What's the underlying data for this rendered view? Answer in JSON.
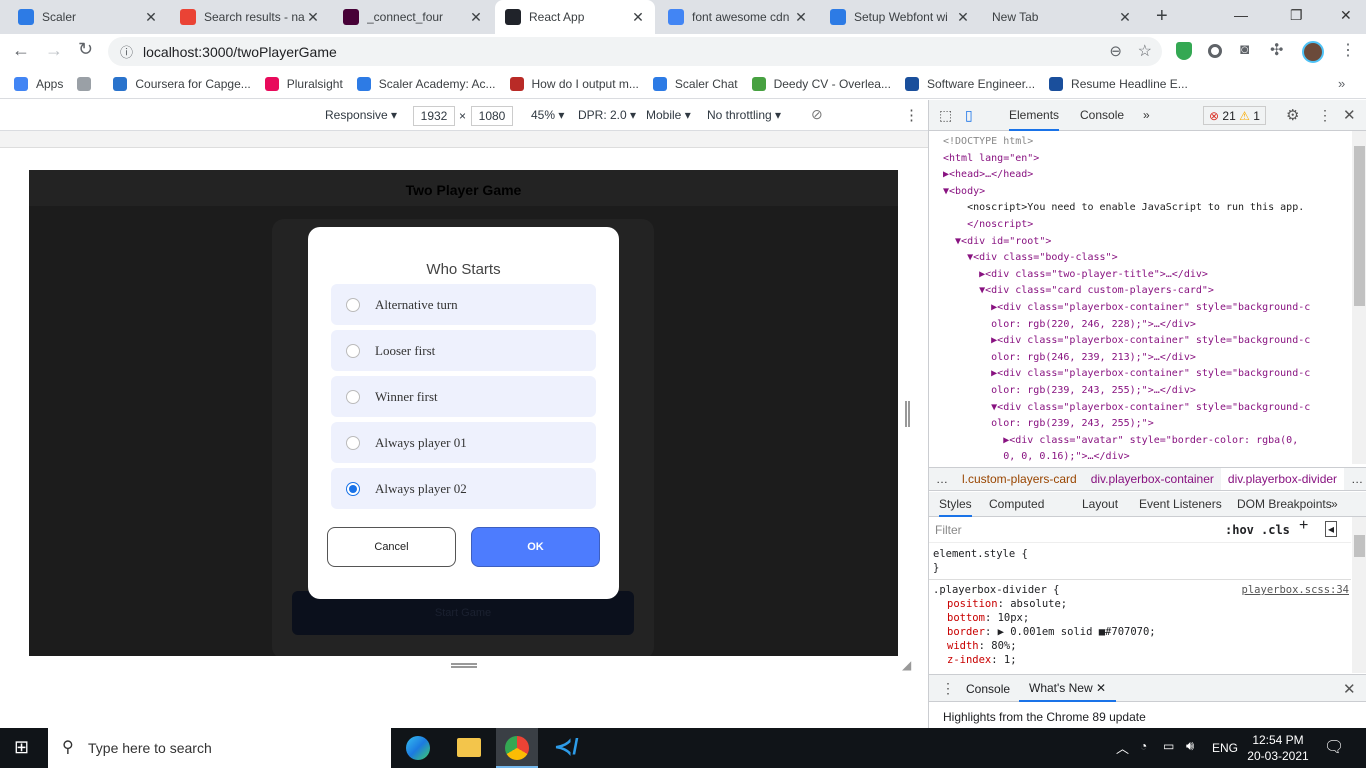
{
  "browser": {
    "tabs": [
      {
        "title": "Scaler",
        "icon": "scaler-icon",
        "color": "#2d7be5"
      },
      {
        "title": "Search results - na",
        "icon": "gmail-icon",
        "color": "#ea4335"
      },
      {
        "title": "_connect_four",
        "icon": "adobe-xd-icon",
        "color": "#470137"
      },
      {
        "title": "React App",
        "icon": "react-icon",
        "color": "#20232a",
        "active": true
      },
      {
        "title": "font awesome cdn",
        "icon": "google-icon",
        "color": "#4285f4"
      },
      {
        "title": "Setup Webfont wi",
        "icon": "flag-icon",
        "color": "#2d7be5"
      },
      {
        "title": "New Tab",
        "icon": "",
        "color": ""
      }
    ],
    "url": "localhost:3000/twoPlayerGame",
    "bookmarks": [
      {
        "label": "Apps",
        "color": "#4285f4"
      },
      {
        "label": "",
        "color": "#9aa0a6"
      },
      {
        "label": "Coursera for Capge...",
        "color": "#2a73cc"
      },
      {
        "label": "Pluralsight",
        "color": "#e80a5b"
      },
      {
        "label": "Scaler Academy: Ac...",
        "color": "#2d7be5"
      },
      {
        "label": "How do I output m...",
        "color": "#b92b27"
      },
      {
        "label": "Scaler Chat",
        "color": "#2d7be5"
      },
      {
        "label": "Deedy CV - Overlea...",
        "color": "#47a141"
      },
      {
        "label": "Software Engineer...",
        "color": "#1a4f9c"
      },
      {
        "label": "Resume Headline E...",
        "color": "#1a4f9c"
      }
    ]
  },
  "device_toolbar": {
    "mode": "Responsive",
    "width": "1932",
    "height": "1080",
    "zoom": "45%",
    "dpr": "DPR: 2.0",
    "device": "Mobile",
    "throttle": "No throttling",
    "times": "×"
  },
  "app": {
    "title": "Two Player Game",
    "start_button": "Start Game",
    "modal": {
      "title": "Who Starts",
      "options": [
        {
          "label": "Alternative turn",
          "checked": false
        },
        {
          "label": "Looser first",
          "checked": false
        },
        {
          "label": "Winner first",
          "checked": false
        },
        {
          "label": "Always player 01",
          "checked": false
        },
        {
          "label": "Always player 02",
          "checked": true
        }
      ],
      "cancel": "Cancel",
      "ok": "OK",
      "accent": "#4d7cfe"
    }
  },
  "devtools": {
    "tabs": [
      "Elements",
      "Console"
    ],
    "errors": "21",
    "warnings": "1",
    "elements": [
      "<!DOCTYPE html>",
      "<html lang=\"en\">",
      "▶<head>…</head>",
      "▼<body>",
      "    <noscript>You need to enable JavaScript to run this app.",
      "    </noscript>",
      "  ▼<div id=\"root\">",
      "    ▼<div class=\"body-class\">",
      "      ▶<div class=\"two-player-title\">…</div>",
      "      ▼<div class=\"card custom-players-card\">",
      "        ▶<div class=\"playerbox-container\" style=\"background-c",
      "        olor: rgb(220, 246, 228);\">…</div>",
      "        ▶<div class=\"playerbox-container\" style=\"background-c",
      "        olor: rgb(246, 239, 213);\">…</div>",
      "        ▶<div class=\"playerbox-container\" style=\"background-c",
      "        olor: rgb(239, 243, 255);\">…</div>",
      "        ▼<div class=\"playerbox-container\" style=\"background-c",
      "        olor: rgb(239, 243, 255);\">",
      "          ▶<div class=\"avatar\" style=\"border-color: rgba(0,",
      "          0, 0, 0.16);\">…</div>"
    ],
    "breadcrumbs": [
      "…",
      "l.custom-players-card",
      "div.playerbox-container",
      "div.playerbox-divider",
      "…"
    ],
    "style_tabs": [
      "Styles",
      "Computed",
      "Layout",
      "Event Listeners",
      "DOM Breakpoints"
    ],
    "filter_placeholder": "Filter",
    "hov": ":hov",
    "cls": ".cls",
    "element_style": "element.style {",
    "close_brace": "}",
    "rule": {
      "selector": ".playerbox-divider {",
      "source": "playerbox.scss:34",
      "props": [
        [
          "position",
          "absolute;"
        ],
        [
          "bottom",
          "10px;"
        ],
        [
          "border",
          "▶ 0.001em solid ■#707070;"
        ],
        [
          "width",
          "80%;"
        ],
        [
          "z-index",
          "1;"
        ]
      ]
    },
    "drawer_tabs": [
      "Console",
      "What's New"
    ],
    "drawer_text": "Highlights from the Chrome 89 update"
  },
  "taskbar": {
    "search_placeholder": "Type here to search",
    "lang": "ENG",
    "time": "12:54 PM",
    "date": "20-03-2021"
  }
}
